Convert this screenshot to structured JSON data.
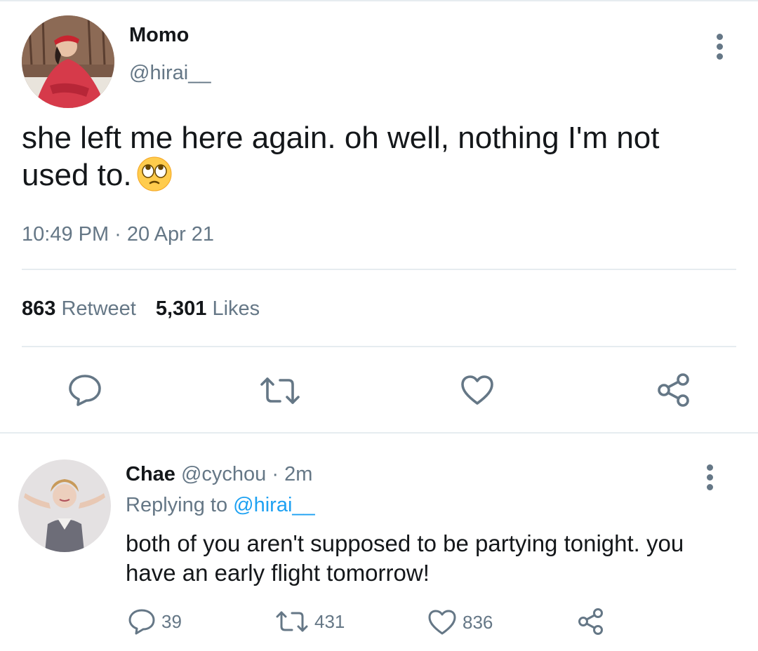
{
  "tweet": {
    "author_name": "Momo",
    "author_handle": "@hirai__",
    "text": "she left me here again. oh well, nothing I'm not used to.",
    "emoji": "face-with-rolling-eyes",
    "timestamp": "10:49 PM · 20 Apr 21",
    "retweet_count": "863",
    "retweet_label": "Retweet",
    "like_count": "5,301",
    "like_label": "Likes"
  },
  "reply": {
    "author_name": "Chae",
    "author_handle": "@cychou",
    "time_sep": " · ",
    "time": "2m",
    "replying_label": "Replying to ",
    "replying_handle": "@hirai__",
    "text": "both of you aren't supposed to be partying tonight. you have an early flight tomorrow!",
    "reply_count": "39",
    "retweet_count": "431",
    "like_count": "836"
  },
  "icons": [
    "more-vertical-icon",
    "reply-icon",
    "retweet-icon",
    "like-icon",
    "share-icon"
  ],
  "colors": {
    "text_primary": "#14171a",
    "text_secondary": "#657786",
    "link": "#1da1f2",
    "divider": "#e6ecf0"
  }
}
